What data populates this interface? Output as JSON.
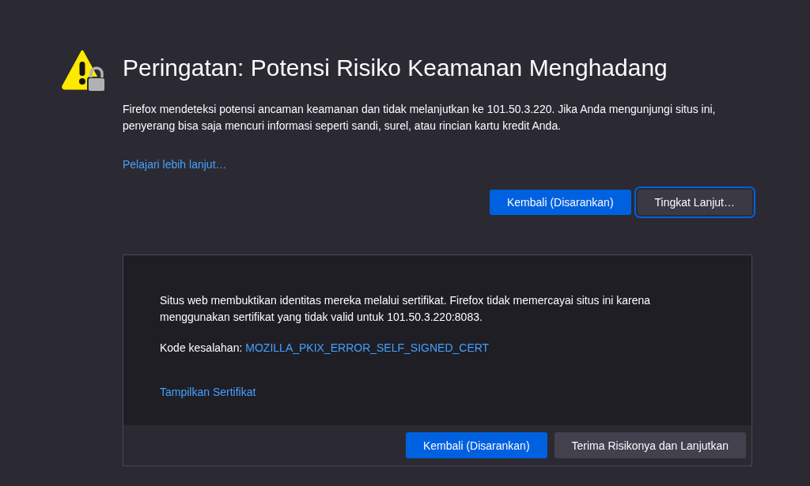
{
  "title": "Peringatan: Potensi Risiko Keamanan Menghadang",
  "description": "Firefox mendeteksi potensi ancaman keamanan dan tidak melanjutkan ke 101.50.3.220. Jika Anda mengunjungi situs ini, penyerang bisa saja mencuri informasi seperti sandi, surel, atau rincian kartu kredit Anda.",
  "learn_more_link": "Pelajari lebih lanjut…",
  "buttons": [
    {
      "label": "Kembali (Disarankan)",
      "kind": "primary",
      "focused": false
    },
    {
      "label": "Tingkat Lanjut…",
      "kind": "secondary",
      "focused": true
    }
  ],
  "advanced_panel": {
    "explanation": "Situs web membuktikan identitas mereka melalui sertifikat. Firefox tidak memercayai situs ini karena menggunakan sertifikat yang tidak valid untuk 101.50.3.220:8083.",
    "error_code_label": "Kode kesalahan:",
    "error_code": "MOZILLA_PKIX_ERROR_SELF_SIGNED_CERT",
    "view_certificate_link": "Tampilkan Sertifikat",
    "buttons": [
      {
        "label": "Kembali (Disarankan)",
        "kind": "primary",
        "focused": false
      },
      {
        "label": "Terima Risikonya dan Lanjutkan",
        "kind": "secondary",
        "focused": false
      }
    ]
  }
}
